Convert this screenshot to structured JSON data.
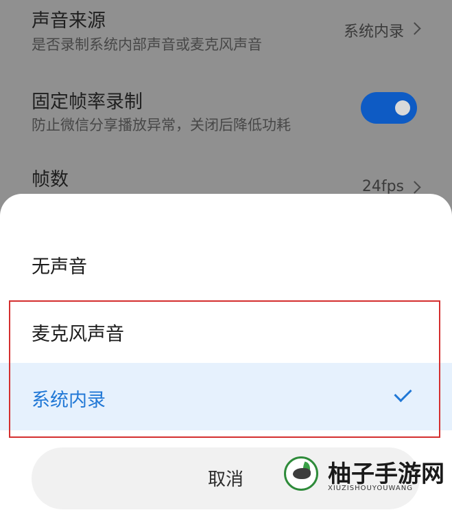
{
  "settings": [
    {
      "title": "声音来源",
      "subtitle": "是否录制系统内部声音或麦克风声音",
      "value": "系统内录"
    },
    {
      "title": "固定帧率录制",
      "subtitle": "防止微信分享播放异常，关闭后降低功耗",
      "toggle_on": true
    },
    {
      "title": "帧数",
      "value": "24fps"
    }
  ],
  "sheet": {
    "options": [
      {
        "label": "无声音",
        "selected": false
      },
      {
        "label": "麦克风声音",
        "selected": false
      },
      {
        "label": "系统内录",
        "selected": true
      }
    ],
    "cancel_label": "取消"
  },
  "watermark": {
    "title": "柚子手游网",
    "subtitle": "XIUZISHOUYOUWANG"
  },
  "colors": {
    "accent": "#2178d6",
    "toggle": "#0e5bc4",
    "highlight_border": "#d42e2e",
    "selected_bg": "#e6f1fd"
  }
}
